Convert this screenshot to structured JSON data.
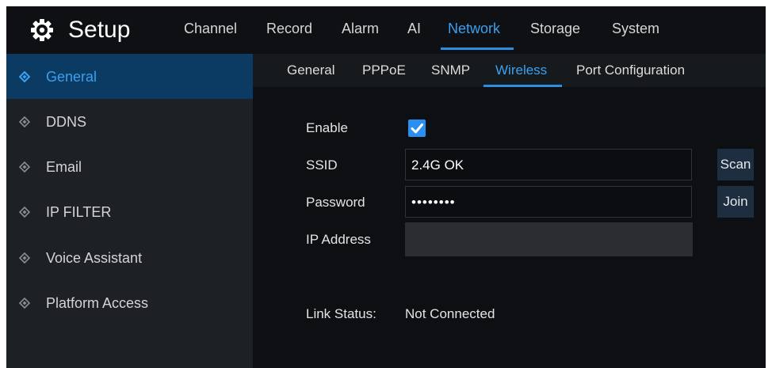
{
  "header": {
    "title": "Setup",
    "icon": "gear-icon",
    "menu": [
      {
        "label": "Channel",
        "active": false
      },
      {
        "label": "Record",
        "active": false
      },
      {
        "label": "Alarm",
        "active": false
      },
      {
        "label": "AI",
        "active": false
      },
      {
        "label": "Network",
        "active": true
      },
      {
        "label": "Storage",
        "active": false
      },
      {
        "label": "System",
        "active": false
      }
    ]
  },
  "sidebar": {
    "items": [
      {
        "label": "General",
        "active": true
      },
      {
        "label": "DDNS",
        "active": false
      },
      {
        "label": "Email",
        "active": false
      },
      {
        "label": "IP FILTER",
        "active": false
      },
      {
        "label": "Voice Assistant",
        "active": false
      },
      {
        "label": "Platform Access",
        "active": false
      }
    ]
  },
  "subtabs": [
    {
      "label": "General",
      "active": false
    },
    {
      "label": "PPPoE",
      "active": false
    },
    {
      "label": "SNMP",
      "active": false
    },
    {
      "label": "Wireless",
      "active": true
    },
    {
      "label": "Port Configuration",
      "active": false
    }
  ],
  "form": {
    "enable_label": "Enable",
    "enable_checked": true,
    "ssid_label": "SSID",
    "ssid_value": "2.4G OK",
    "password_label": "Password",
    "password_value": "••••••••",
    "ip_label": "IP Address",
    "ip_value": "",
    "scan_label": "Scan",
    "join_label": "Join",
    "link_status_label": "Link Status:",
    "link_status_value": "Not Connected"
  },
  "colors": {
    "accent": "#3aa0ef",
    "checkbox": "#2a8ff0",
    "sidebar_active_bg": "#0b3a63",
    "background": "#0d0f12"
  }
}
